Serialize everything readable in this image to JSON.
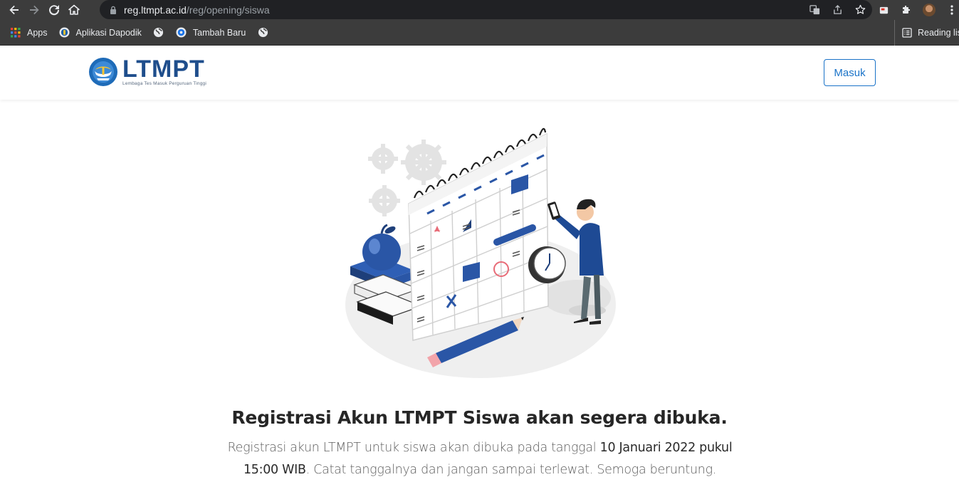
{
  "browser": {
    "url_host": "reg.ltmpt.ac.id",
    "url_path": "/reg/opening/siswa",
    "bookmarks": [
      {
        "label": "Apps",
        "icon": "apps-grid-icon"
      },
      {
        "label": "Aplikasi Dapodik",
        "icon": "dapodik-icon"
      },
      {
        "label": "",
        "icon": "globe-icon"
      },
      {
        "label": "Tambah Baru",
        "icon": "tambah-baru-icon"
      },
      {
        "label": "",
        "icon": "globe-icon"
      }
    ],
    "reading_list": "Reading list"
  },
  "header": {
    "logo_text": "LTMPT",
    "logo_subtitle": "Lembaga Tes Masuk Perguruan Tinggi",
    "login_button": "Masuk"
  },
  "main": {
    "headline": "Registrasi Akun LTMPT Siswa akan segera dibuka.",
    "desc_part1": "Registrasi akun LTMPT untuk siswa akan dibuka pada tanggal ",
    "desc_date": "10 Januari 2022 pukul 15:00 WIB",
    "desc_part2": ". Catat tanggalnya dan jangan sampai terlewat. Semoga beruntung."
  },
  "colors": {
    "brand_blue": "#1f4e8c",
    "button_blue": "#1a73c8",
    "chrome_bg": "#3c3c3c"
  }
}
